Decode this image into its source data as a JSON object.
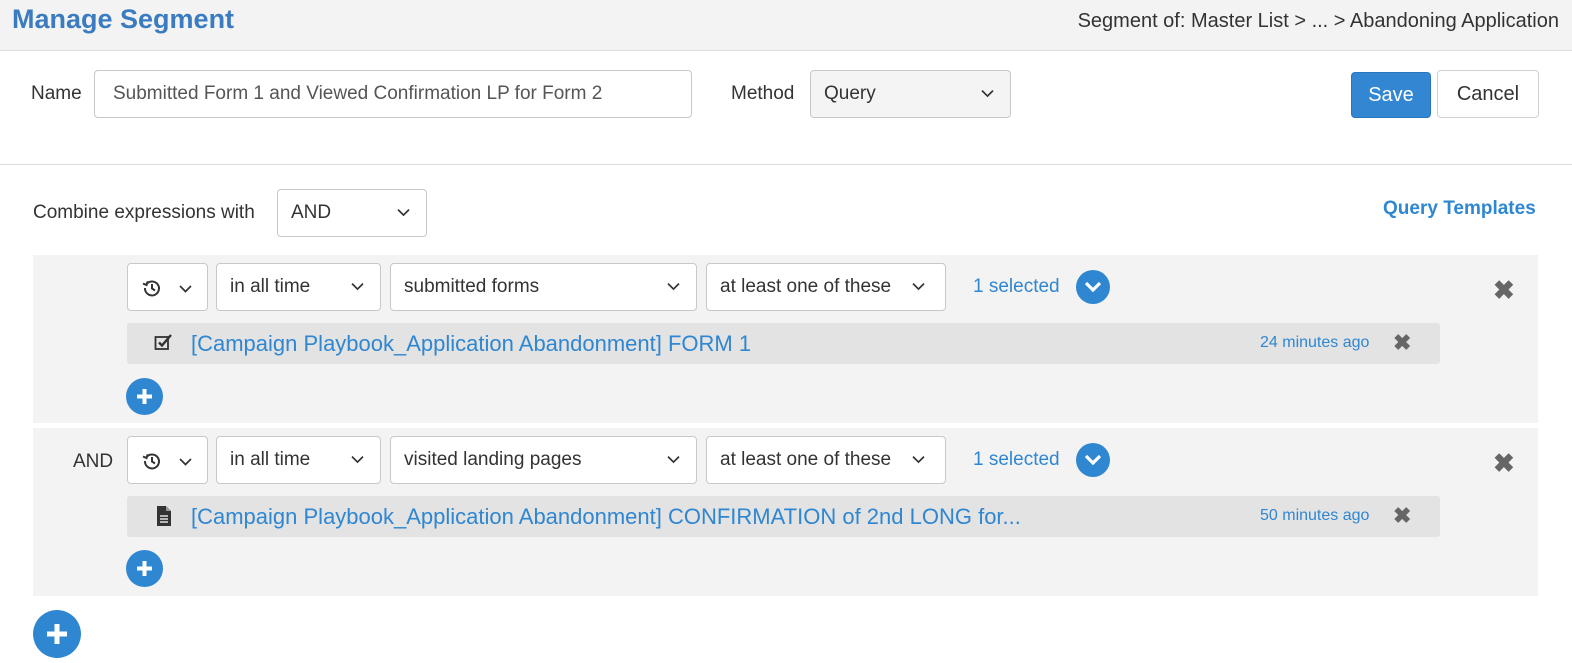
{
  "header": {
    "title": "Manage Segment",
    "breadcrumb": "Segment of: Master List > ... > Abandoning Application"
  },
  "form": {
    "name_label": "Name",
    "name_value": "Submitted Form 1 and Viewed Confirmation LP for Form 2",
    "method_label": "Method",
    "method_value": "Query",
    "save_label": "Save",
    "cancel_label": "Cancel"
  },
  "query": {
    "combine_label": "Combine expressions with",
    "combine_value": "AND",
    "templates_link": "Query Templates",
    "expressions": [
      {
        "operator": "",
        "timeframe": "in all time",
        "activity": "submitted forms",
        "match": "at least one of these",
        "selected_count": "1 selected",
        "item_icon": "checkbox-icon",
        "item_name": "[Campaign Playbook_Application Abandonment] FORM 1",
        "item_time": "24 minutes ago"
      },
      {
        "operator": "AND",
        "timeframe": "in all time",
        "activity": "visited landing pages",
        "match": "at least one of these",
        "selected_count": "1 selected",
        "item_icon": "document-icon",
        "item_name": "[Campaign Playbook_Application Abandonment] CONFIRMATION of 2nd LONG for...",
        "item_time": "50 minutes ago"
      }
    ]
  },
  "icons": {
    "history": "history-icon",
    "chevron": "chevron-down-icon",
    "remove": "close-icon",
    "add": "plus-icon"
  },
  "colors": {
    "accent": "#2f86d1",
    "title": "#3a7cbf",
    "panel": "#f3f3f3",
    "item": "#e3e3e3"
  }
}
